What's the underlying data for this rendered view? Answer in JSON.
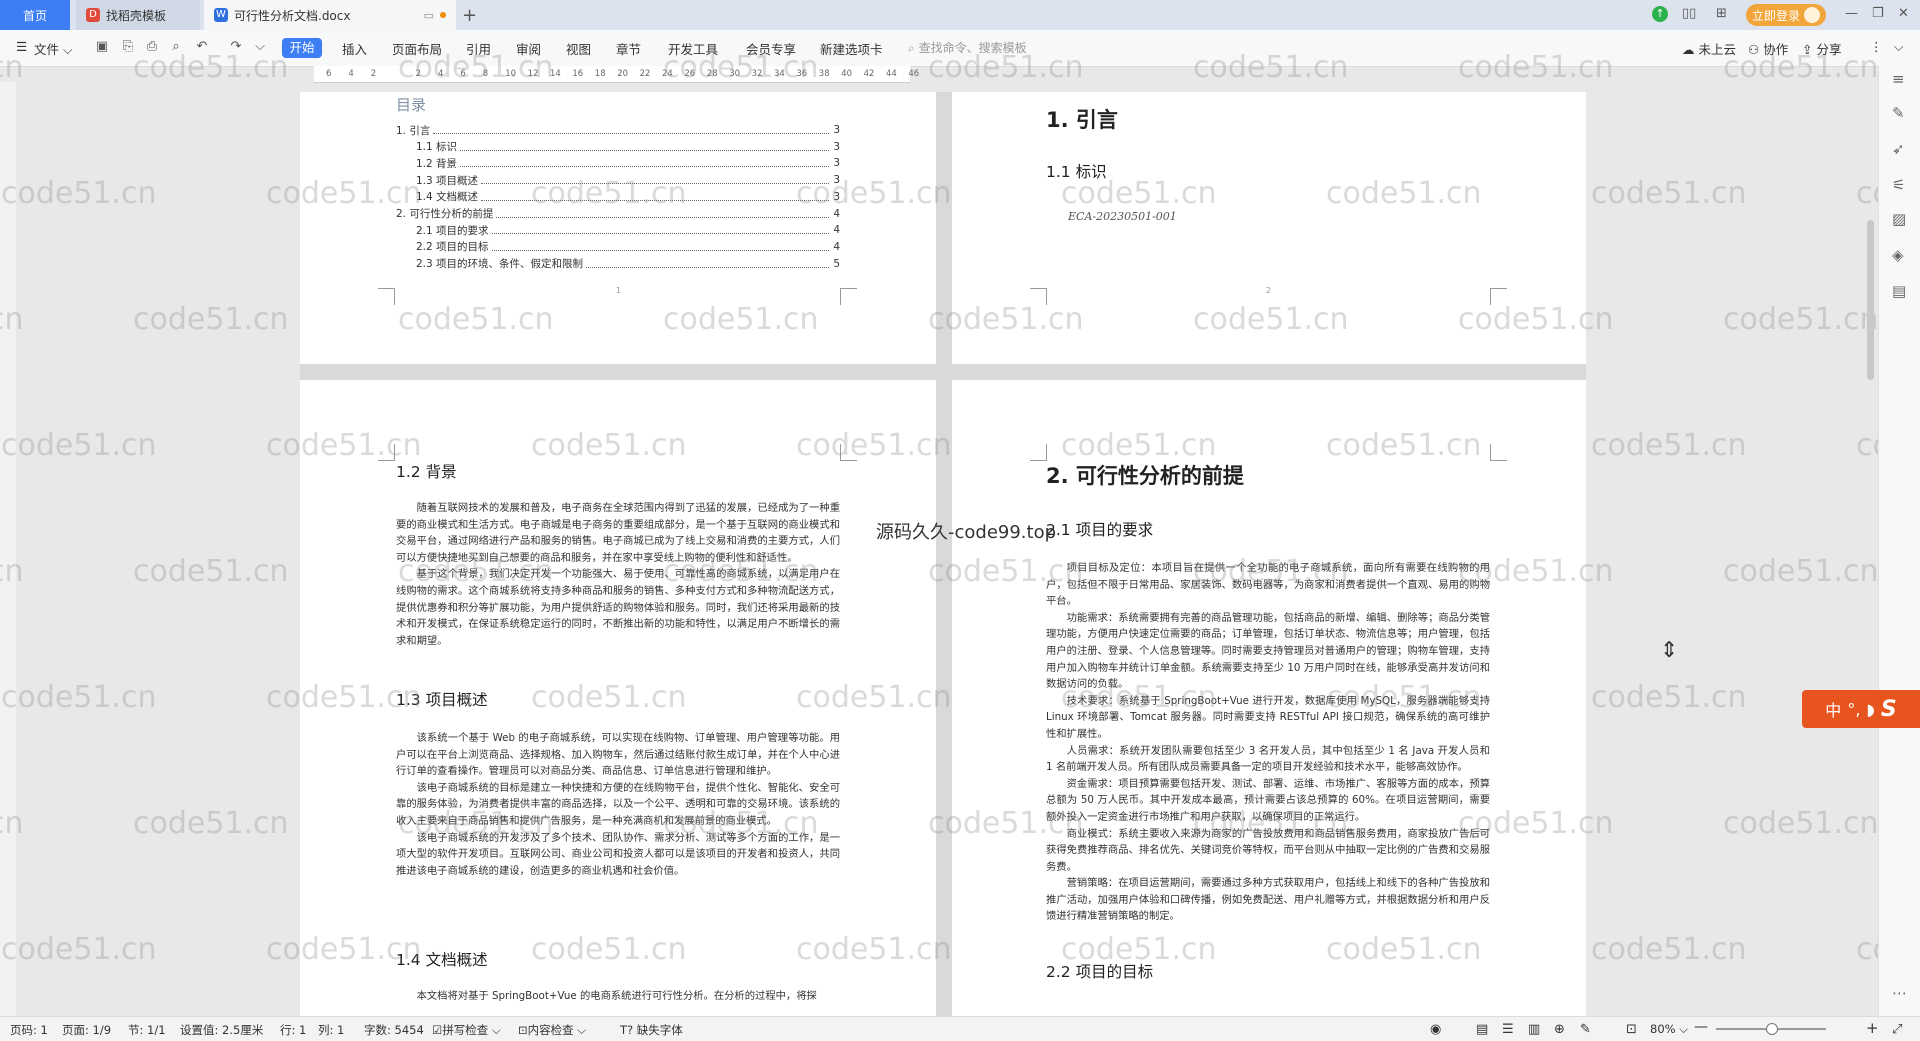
{
  "tabs": {
    "home": "首页",
    "template": "找稻壳模板",
    "doc": "可行性分析文档.docx",
    "login": "立即登录"
  },
  "toolbar": {
    "file": "文件",
    "start": "开始",
    "menus": [
      "插入",
      "页面布局",
      "引用",
      "审阅",
      "视图",
      "章节",
      "开发工具",
      "会员专享",
      "新建选项卡"
    ],
    "search_placeholder": "查找命令、搜索模板",
    "cloud": "未上云",
    "collab": "协作",
    "share": "分享"
  },
  "ruler": [
    "6",
    "4",
    "2",
    "",
    "2",
    "4",
    "6",
    "8",
    "10",
    "12",
    "14",
    "16",
    "18",
    "20",
    "22",
    "24",
    "26",
    "28",
    "30",
    "32",
    "34",
    "36",
    "38",
    "40",
    "42",
    "44",
    "46"
  ],
  "toc": {
    "title": "目录",
    "items": [
      {
        "text": "1. 引言",
        "page": "3",
        "level": 0
      },
      {
        "text": "1.1  标识",
        "page": "3",
        "level": 1
      },
      {
        "text": "1.2  背景",
        "page": "3",
        "level": 1
      },
      {
        "text": "1.3  项目概述",
        "page": "3",
        "level": 1
      },
      {
        "text": "1.4  文档概述",
        "page": "3",
        "level": 1
      },
      {
        "text": "2.  可行性分析的前提",
        "page": "4",
        "level": 0
      },
      {
        "text": "2.1  项目的要求",
        "page": "4",
        "level": 1
      },
      {
        "text": "2.2  项目的目标",
        "page": "4",
        "level": 1
      },
      {
        "text": "2.3  项目的环境、条件、假定和限制",
        "page": "5",
        "level": 1
      }
    ],
    "page_num": "1"
  },
  "page2": {
    "h1": "1.  引言",
    "h2": "1.1  标识",
    "code": "ECA-20230501-001",
    "page_num": "2"
  },
  "page3": {
    "h_bg": "1.2  背景",
    "bg": [
      "随着互联网技术的发展和普及，电子商务在全球范围内得到了迅猛的发展，已经成为了一种重要的商业模式和生活方式。电子商城是电子商务的重要组成部分，是一个基于互联网的商业模式和交易平台，通过网络进行产品和服务的销售。电子商城已成为了线上交易和消费的主要方式，人们可以方便快捷地买到自己想要的商品和服务，并在家中享受线上购物的便利性和舒适性。",
      "基于这个背景，我们决定开发一个功能强大、易于使用、可靠性高的商城系统，以满足用户在线购物的需求。这个商城系统将支持多种商品和服务的销售、多种支付方式和多种物流配送方式，提供优惠券和积分等扩展功能，为用户提供舒适的购物体验和服务。同时，我们还将采用最新的技术和开发模式，在保证系统稳定运行的同时，不断推出新的功能和特性，以满足用户不断增长的需求和期望。"
    ],
    "h_overview": "1.3  项目概述",
    "overview": [
      "该系统一个基于 Web 的电子商城系统，可以实现在线购物、订单管理、用户管理等功能。用户可以在平台上浏览商品、选择规格、加入购物车，然后通过结账付款生成订单，并在个人中心进行订单的查看操作。管理员可以对商品分类、商品信息、订单信息进行管理和维护。",
      "该电子商城系统的目标是建立一种快捷和方便的在线购物平台，提供个性化、智能化、安全可靠的服务体验，为消费者提供丰富的商品选择，以及一个公平、透明和可靠的交易环境。该系统的收入主要来自于商品销售和提供广告服务，是一种充满商机和发展前景的商业模式。",
      "该电子商城系统的开发涉及了多个技术、团队协作、需求分析、测试等多个方面的工作，是一项大型的软件开发项目。互联网公司、商业公司和投资人都可以是该项目的开发者和投资人，共同推进该电子商城系统的建设，创造更多的商业机遇和社会价值。"
    ],
    "h_doc": "1.4  文档概述",
    "doc": "本文档将对基于 SpringBoot+Vue 的电商系统进行可行性分析。在分析的过程中，将探"
  },
  "page4": {
    "h1": "2.  可行性分析的前提",
    "h2": "2.1  项目的要求",
    "paras": [
      "项目目标及定位：本项目旨在提供一个全功能的电子商城系统，面向所有需要在线购物的用户，包括但不限于日常用品、家居装饰、数码电器等，为商家和消费者提供一个直观、易用的购物平台。",
      "功能需求：系统需要拥有完善的商品管理功能，包括商品的新增、编辑、删除等；商品分类管理功能，方便用户快速定位需要的商品；订单管理，包括订单状态、物流信息等；用户管理，包括用户的注册、登录、个人信息管理等。同时需要支持管理员对普通用户的管理；购物车管理，支持用户加入购物车并统计订单金额。系统需要支持至少 10 万用户同时在线，能够承受高并发访问和数据访问的负载。",
      "技术要求：系统基于 SpringBoot+Vue 进行开发，数据库使用 MySQL，服务器端能够支持 Linux 环境部署、Tomcat 服务器。同时需要支持 RESTful API 接口规范，确保系统的高可维护性和扩展性。",
      "人员需求：系统开发团队需要包括至少 3 名开发人员，其中包括至少 1 名 Java 开发人员和 1 名前端开发人员。所有团队成员需要具备一定的项目开发经验和技术水平，能够高效协作。",
      "资金需求：项目预算需要包括开发、测试、部署、运维、市场推广、客服等方面的成本，预算总额为 50 万人民币。其中开发成本最高，预计需要占该总预算的 60%。在项目运营期间，需要额外投入一定资金进行市场推广和用户获取，以确保项目的正常运行。",
      "商业模式：系统主要收入来源为商家的广告投放费用和商品销售服务费用，商家投放广告后可获得免费推荐商品、排名优先、关键词竞价等特权，而平台则从中抽取一定比例的广告费和交易服务费。",
      "营销策略：在项目运营期间，需要通过多种方式获取用户，包括线上和线下的各种广告投放和推广活动，加强用户体验和口碑传播，例如免费配送、用户礼赠等方式，并根据数据分析和用户反馈进行精准营销策略的制定。"
    ],
    "h2b": "2.2  项目的目标"
  },
  "watermark": "code51.cn",
  "watermark_center": "源码久久-code99.top",
  "ime": "中",
  "status": {
    "page": "页码: 1",
    "pages": "页面: 1/9",
    "section": "节: 1/1",
    "setting": "设置值: 2.5厘米",
    "row": "行: 1",
    "col": "列: 1",
    "words": "字数: 5454",
    "spell": "拼写检查",
    "content": "内容检查",
    "font": "缺失字体",
    "zoom": "80%"
  }
}
